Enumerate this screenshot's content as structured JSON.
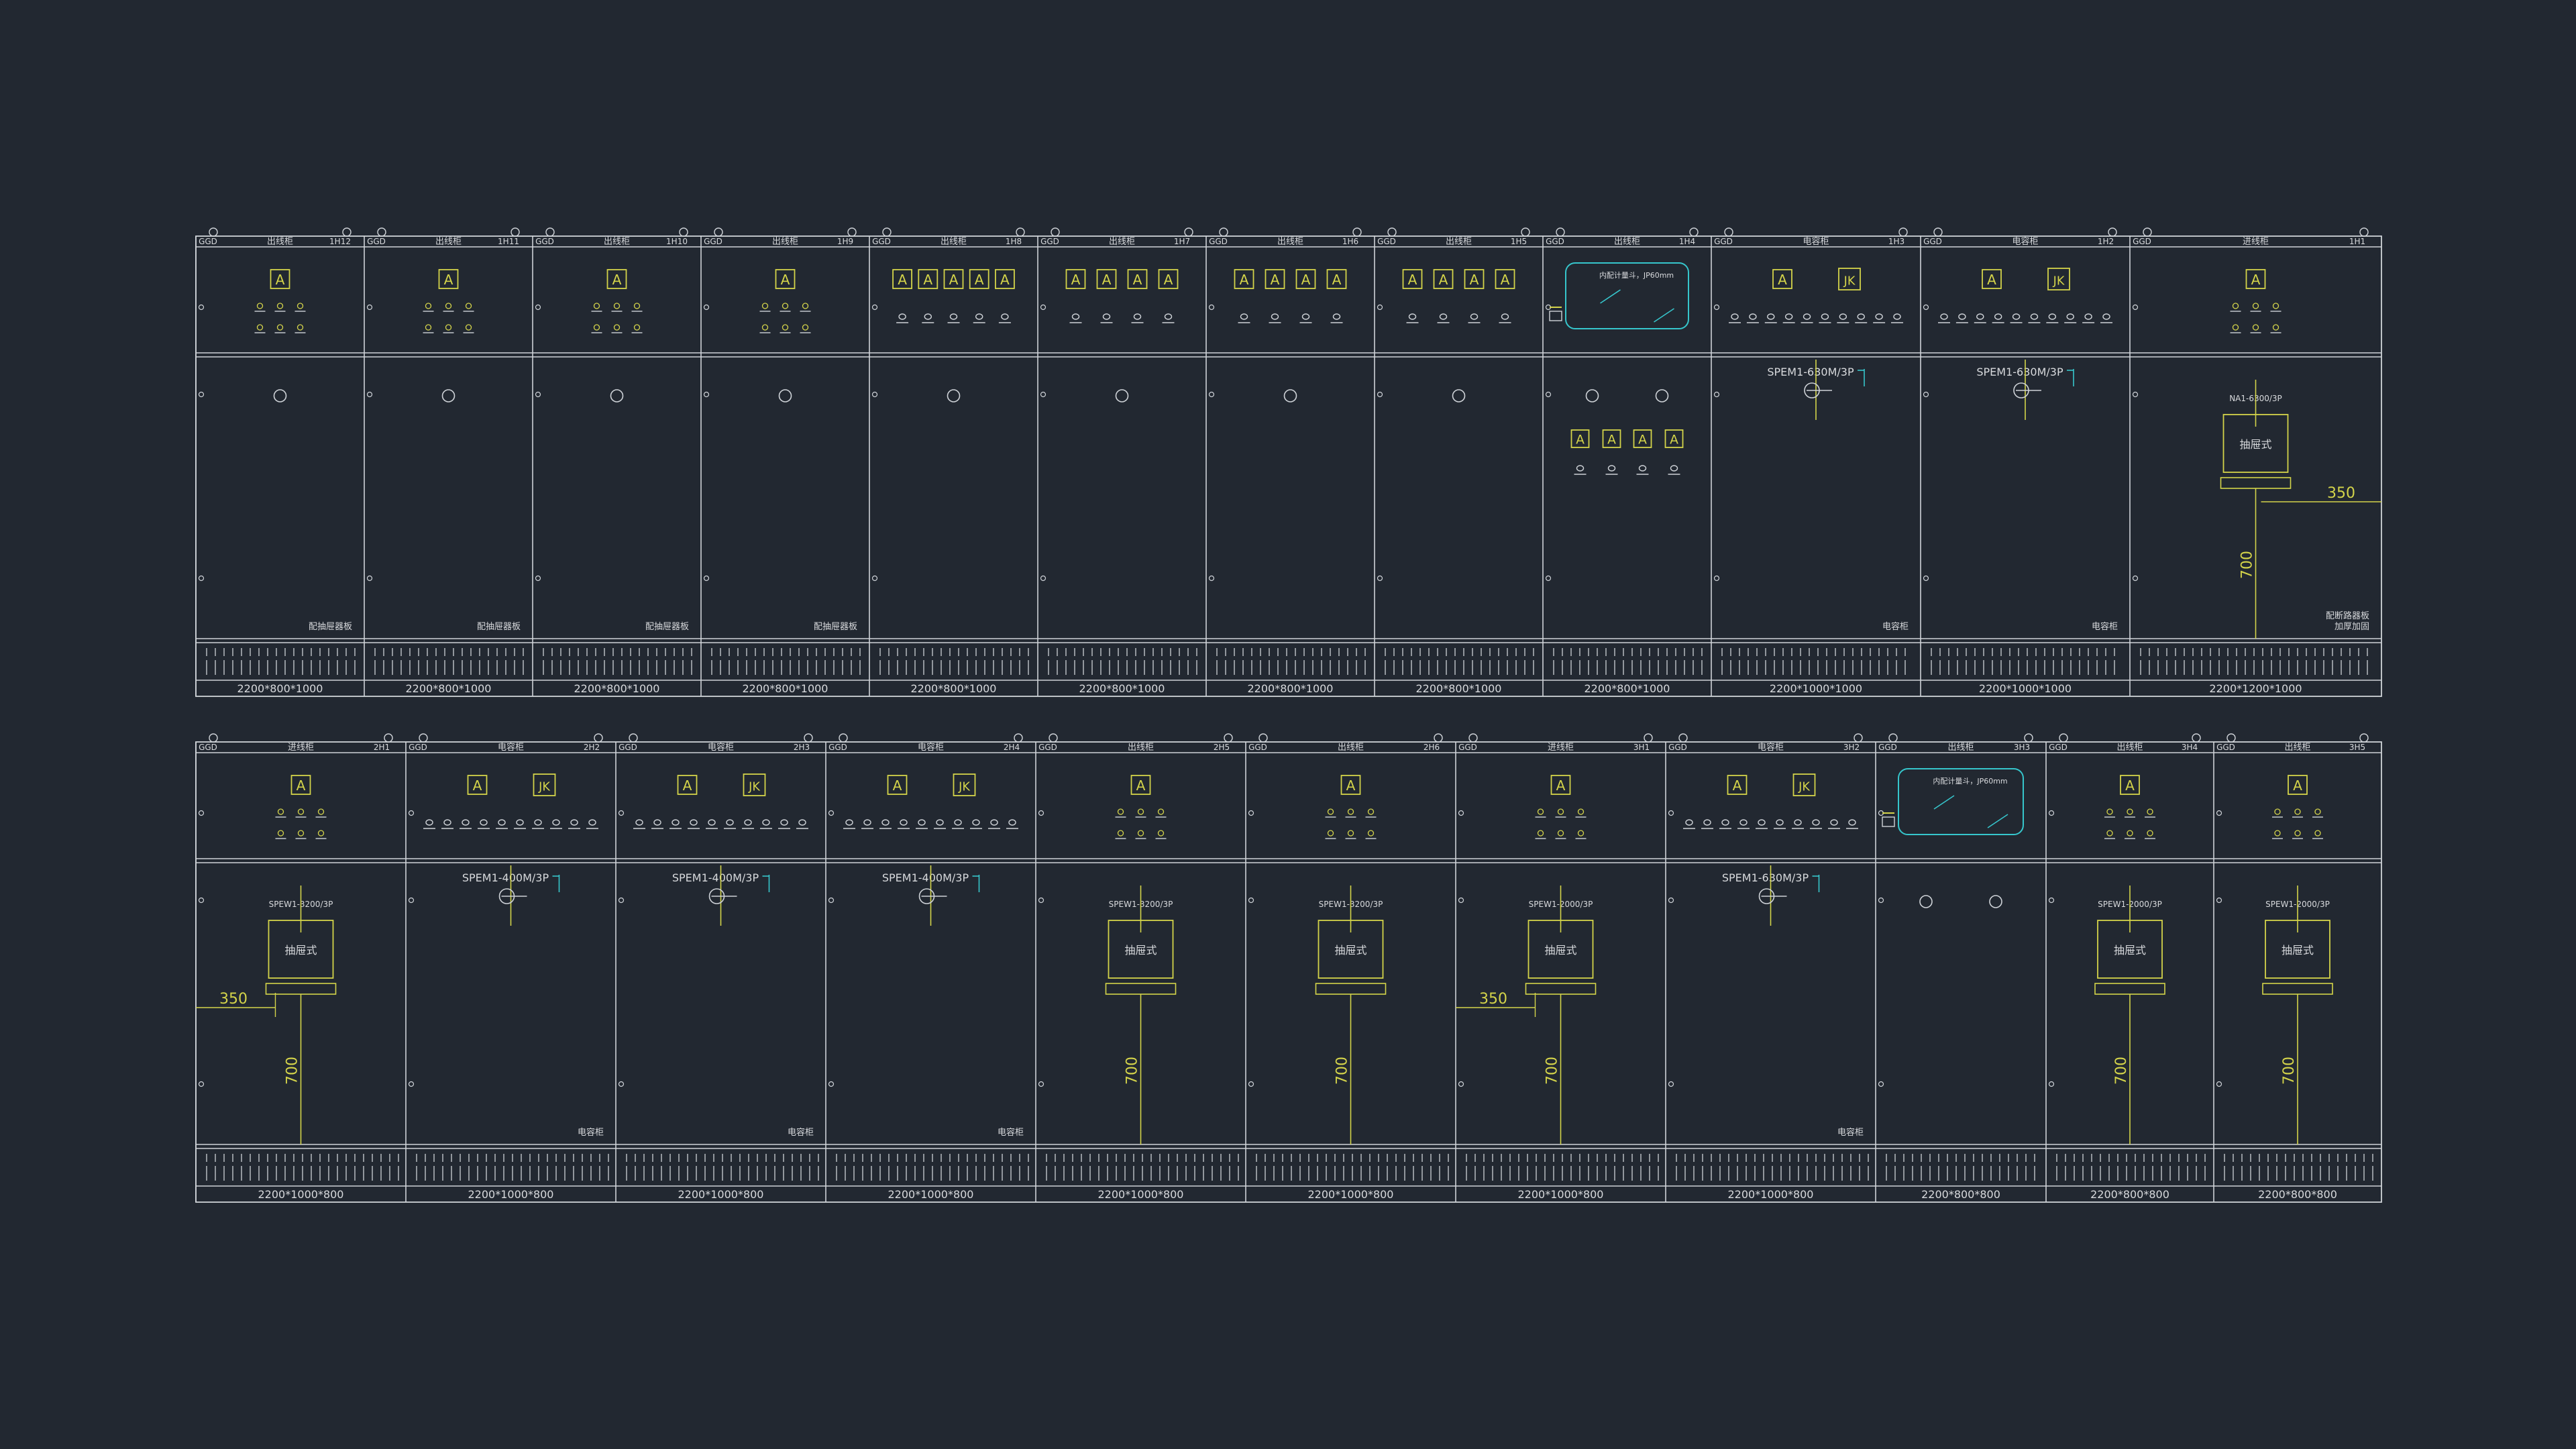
{
  "colors": {
    "background": "#222831",
    "line": "#cfd3d8",
    "yellow": "#d4d44a",
    "cyan": "#36c6cc",
    "text": "#d8dadd"
  },
  "rows": [
    {
      "panels": [
        {
          "type": "GGD",
          "name": "出线柜",
          "code": "1H12",
          "size": "2200*800*1000",
          "top": "meters3",
          "mid": "circle",
          "note": "配抽屉器板"
        },
        {
          "type": "GGD",
          "name": "出线柜",
          "code": "1H11",
          "size": "2200*800*1000",
          "top": "meters3",
          "mid": "circle",
          "note": "配抽屉器板"
        },
        {
          "type": "GGD",
          "name": "出线柜",
          "code": "1H10",
          "size": "2200*800*1000",
          "top": "meters3",
          "mid": "circle",
          "note": "配抽屉器板"
        },
        {
          "type": "GGD",
          "name": "出线柜",
          "code": "1H9",
          "size": "2200*800*1000",
          "top": "meters3",
          "mid": "circle",
          "note": "配抽屉器板"
        },
        {
          "type": "GGD",
          "name": "出线柜",
          "code": "1H8",
          "size": "2200*800*1000",
          "top": "meters5",
          "mid": "circle",
          "note": ""
        },
        {
          "type": "GGD",
          "name": "出线柜",
          "code": "1H7",
          "size": "2200*800*1000",
          "top": "meters4",
          "mid": "circle",
          "note": ""
        },
        {
          "type": "GGD",
          "name": "出线柜",
          "code": "1H6",
          "size": "2200*800*1000",
          "top": "meters4",
          "mid": "circle",
          "note": ""
        },
        {
          "type": "GGD",
          "name": "出线柜",
          "code": "1H5",
          "size": "2200*800*1000",
          "top": "meters4",
          "mid": "circle",
          "note": ""
        },
        {
          "type": "GGD",
          "name": "出线柜",
          "code": "1H4",
          "size": "2200*800*1000",
          "top": "window",
          "mid": "meters_mid",
          "note": "",
          "window_text": "内配计量斗，JP60mm"
        },
        {
          "type": "GGD",
          "name": "电容柜",
          "code": "1H3",
          "size": "2200*1000*1000",
          "top": "capacitor",
          "mid": "switch",
          "note": "电容柜",
          "breaker": "SPEM1-630M/3P"
        },
        {
          "type": "GGD",
          "name": "电容柜",
          "code": "1H2",
          "size": "2200*1000*1000",
          "top": "capacitor",
          "mid": "switch",
          "note": "电容柜",
          "breaker": "SPEM1-630M/3P"
        },
        {
          "type": "GGD",
          "name": "进线柜",
          "code": "1H1",
          "size": "2200*1200*1000",
          "top": "meters3",
          "mid": "incoming",
          "note": "配断路器板\n加厚加固",
          "breaker": "NA1-6300/3P",
          "drawer": "抽屉式",
          "dim_h": "350",
          "dim_v": "700",
          "dim_side": "right"
        }
      ]
    },
    {
      "panels": [
        {
          "type": "GGD",
          "name": "进线柜",
          "code": "2H1",
          "size": "2200*1000*800",
          "top": "meters3",
          "mid": "incoming",
          "note": "",
          "breaker": "SPEW1-3200/3P",
          "drawer": "抽屉式",
          "dim_h": "350",
          "dim_v": "700",
          "dim_side": "left"
        },
        {
          "type": "GGD",
          "name": "电容柜",
          "code": "2H2",
          "size": "2200*1000*800",
          "top": "capacitor",
          "mid": "switch",
          "note": "电容柜",
          "breaker": "SPEM1-400M/3P"
        },
        {
          "type": "GGD",
          "name": "电容柜",
          "code": "2H3",
          "size": "2200*1000*800",
          "top": "capacitor",
          "mid": "switch",
          "note": "电容柜",
          "breaker": "SPEM1-400M/3P"
        },
        {
          "type": "GGD",
          "name": "电容柜",
          "code": "2H4",
          "size": "2200*1000*800",
          "top": "capacitor",
          "mid": "switch",
          "note": "电容柜",
          "breaker": "SPEM1-400M/3P"
        },
        {
          "type": "GGD",
          "name": "出线柜",
          "code": "2H5",
          "size": "2200*1000*800",
          "top": "meters3",
          "mid": "incoming",
          "note": "",
          "breaker": "SPEW1-3200/3P",
          "drawer": "抽屉式",
          "dim_h": "",
          "dim_v": "700",
          "dim_side": "none"
        },
        {
          "type": "GGD",
          "name": "出线柜",
          "code": "2H6",
          "size": "2200*1000*800",
          "top": "meters3",
          "mid": "incoming",
          "note": "",
          "breaker": "SPEW1-3200/3P",
          "drawer": "抽屉式",
          "dim_h": "",
          "dim_v": "700",
          "dim_side": "none"
        },
        {
          "type": "GGD",
          "name": "进线柜",
          "code": "3H1",
          "size": "2200*1000*800",
          "top": "meters3",
          "mid": "incoming",
          "note": "",
          "breaker": "SPEW1-2000/3P",
          "drawer": "抽屉式",
          "dim_h": "350",
          "dim_v": "700",
          "dim_side": "left"
        },
        {
          "type": "GGD",
          "name": "电容柜",
          "code": "3H2",
          "size": "2200*1000*800",
          "top": "capacitor",
          "mid": "switch",
          "note": "电容柜",
          "breaker": "SPEM1-630M/3P"
        },
        {
          "type": "GGD",
          "name": "出线柜",
          "code": "3H3",
          "size": "2200*800*800",
          "top": "window",
          "mid": "two_circles",
          "note": "",
          "window_text": "内配计量斗，JP60mm"
        },
        {
          "type": "GGD",
          "name": "出线柜",
          "code": "3H4",
          "size": "2200*800*800",
          "top": "meters3",
          "mid": "incoming",
          "note": "",
          "breaker": "SPEW1-2000/3P",
          "drawer": "抽屉式",
          "dim_h": "",
          "dim_v": "700",
          "dim_side": "none"
        },
        {
          "type": "GGD",
          "name": "出线柜",
          "code": "3H5",
          "size": "2200*800*800",
          "top": "meters3",
          "mid": "incoming",
          "note": "",
          "breaker": "SPEW1-2000/3P",
          "drawer": "抽屉式",
          "dim_h": "",
          "dim_v": "700",
          "dim_side": "none"
        }
      ]
    }
  ],
  "symbols": {
    "ammeter": "A",
    "controller": "JK"
  }
}
